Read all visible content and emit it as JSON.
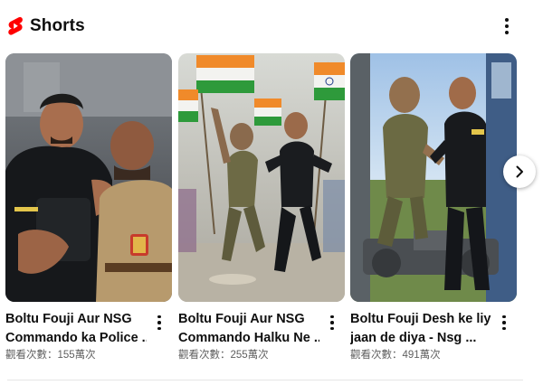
{
  "shelf": {
    "title": "Shorts",
    "logo_icon": "youtube-shorts-logo-icon",
    "menu_icon": "more-vert-icon",
    "accent_color": "#ff0000"
  },
  "cards": [
    {
      "title_line1": "Boltu Fouji Aur NSG",
      "title_line2": "Commando ka Police ...",
      "views": "觀看次數：155萬次",
      "thumbnail_alt": "Commando and police officer confronting each other"
    },
    {
      "title_line1": "Boltu Fouji Aur NSG",
      "title_line2": "Commando Halku Ne ...",
      "views": "觀看次數：255萬次",
      "thumbnail_alt": "Monkey soldier and commando running with Indian flags"
    },
    {
      "title_line1": "Boltu Fouji Desh ke liye",
      "title_line2": "jaan de diya - Nsg ...",
      "views": "觀看次數：491萬次",
      "thumbnail_alt": "Monkey soldier fighting a commando on a train coupling"
    }
  ],
  "navigation": {
    "next_icon": "chevron-right-icon"
  }
}
